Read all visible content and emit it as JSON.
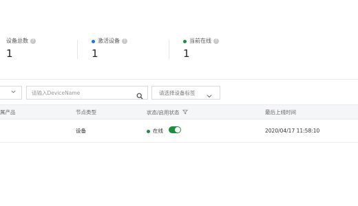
{
  "stats": [
    {
      "label": "设备总数",
      "value": "1",
      "dot_color": null
    },
    {
      "label": "激活设备",
      "value": "1",
      "dot_color": "#1a73e8"
    },
    {
      "label": "当前在线",
      "value": "1",
      "dot_color": "#1e8e3e"
    }
  ],
  "filters": {
    "search_placeholder": "请输入DeviceName",
    "tag_placeholder": "请选择设备标签"
  },
  "table": {
    "columns": [
      "属产品",
      "节点类型",
      "状态/启用状态",
      "最后上线时间"
    ],
    "rows": [
      {
        "node_type": "设备",
        "status": "在线",
        "enabled": true,
        "last_online": "2020/04/17 11:58:10"
      }
    ]
  },
  "colors": {
    "online": "#1e8e3e",
    "active": "#1a73e8",
    "toggle_on": "#1e8e3e"
  }
}
